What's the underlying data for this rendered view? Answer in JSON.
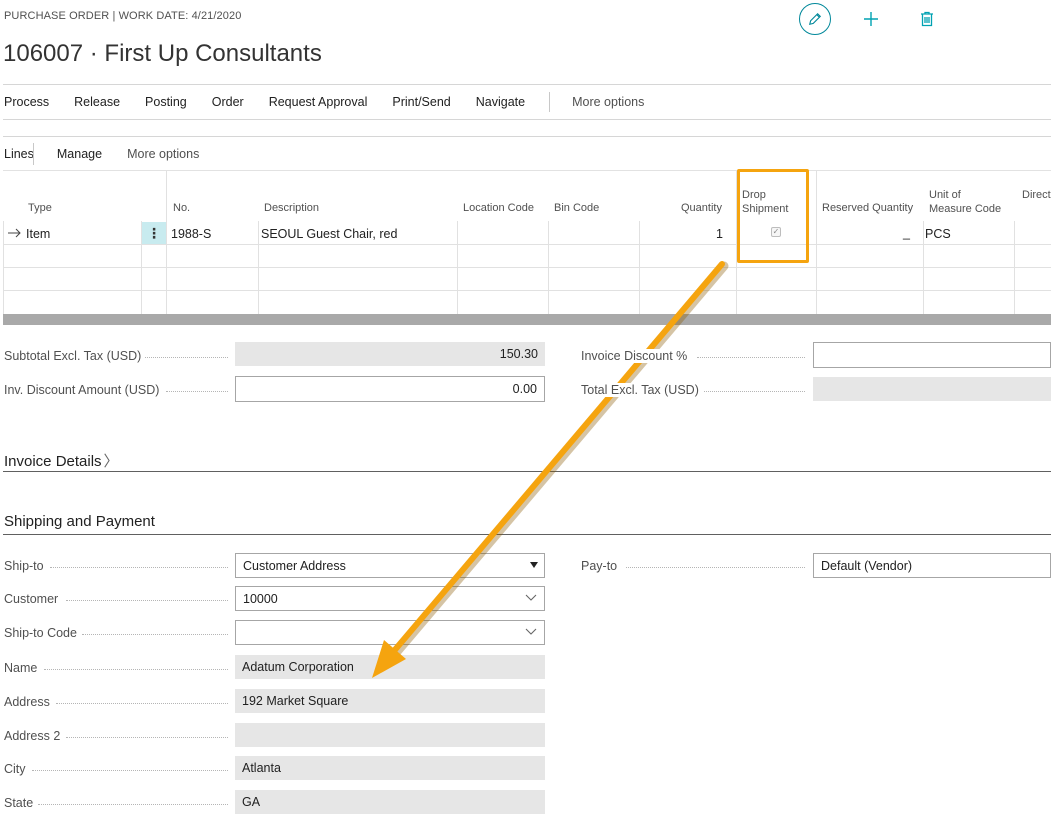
{
  "header": {
    "caption": "PURCHASE ORDER | WORK DATE: 4/21/2020",
    "title": "106007 · First Up Consultants",
    "icons": [
      "pencil-icon",
      "plus-icon",
      "trash-icon"
    ]
  },
  "actions": [
    "Process",
    "Release",
    "Posting",
    "Order",
    "Request Approval",
    "Print/Send",
    "Navigate"
  ],
  "actions_more": "More options",
  "lines_bar": {
    "label": "Lines",
    "manage": "Manage",
    "more": "More options"
  },
  "grid": {
    "columns": {
      "type": "Type",
      "no": "No.",
      "description": "Description",
      "location": "Location Code",
      "bin": "Bin Code",
      "quantity": "Quantity",
      "drop_1": "Drop",
      "drop_2": "Shipment",
      "reserved": "Reserved Quantity",
      "uom_1": "Unit of",
      "uom_2": "Measure Code",
      "direct": "Direct"
    },
    "row": {
      "type": "Item",
      "no": "1988-S",
      "description": "SEOUL Guest Chair, red",
      "quantity": "1",
      "drop_shipment": true,
      "reserved": "_",
      "uom": "PCS"
    }
  },
  "totals": {
    "subtotal_label": "Subtotal Excl. Tax (USD)",
    "subtotal_value": "150.30",
    "inv_discount_label": "Inv. Discount Amount (USD)",
    "inv_discount_value": "0.00",
    "invoice_discount_pct_label": "Invoice Discount %",
    "total_excl_label": "Total Excl. Tax (USD)"
  },
  "invoice_details": "Invoice Details",
  "shipping": {
    "title": "Shipping and Payment",
    "ship_to_label": "Ship-to",
    "ship_to_value": "Customer Address",
    "customer_label": "Customer",
    "customer_value": "10000",
    "ship_to_code_label": "Ship-to Code",
    "ship_to_code_value": "",
    "name_label": "Name",
    "name_value": "Adatum Corporation",
    "address_label": "Address",
    "address_value": "192 Market Square",
    "address2_label": "Address 2",
    "address2_value": "",
    "city_label": "City",
    "city_value": "Atlanta",
    "state_label": "State",
    "state_value": "GA",
    "pay_to_label": "Pay-to",
    "pay_to_value": "Default (Vendor)"
  },
  "colors": {
    "accent": "#00a2b2",
    "annotation": "#f5a40f",
    "readonly_field": "#e6e6e6"
  }
}
